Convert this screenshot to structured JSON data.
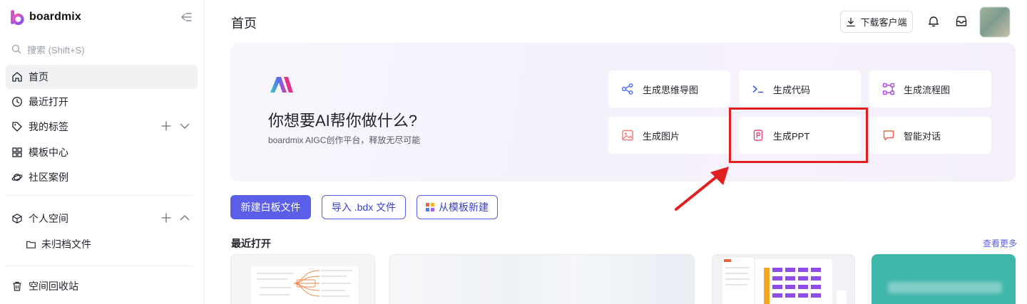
{
  "brand": {
    "name": "boardmix"
  },
  "sidebar": {
    "search_placeholder": "搜索 (Shift+S)",
    "items": [
      {
        "label": "首页",
        "icon": "home-icon",
        "active": true
      },
      {
        "label": "最近打开",
        "icon": "clock-icon"
      },
      {
        "label": "我的标签",
        "icon": "tag-icon"
      },
      {
        "label": "模板中心",
        "icon": "template-icon"
      },
      {
        "label": "社区案例",
        "icon": "planet-icon"
      }
    ],
    "personal_space": {
      "label": "个人空间",
      "icon": "cube-icon"
    },
    "unfiled": {
      "label": "未归档文件",
      "icon": "folder-icon"
    },
    "trash": {
      "label": "空间回收站",
      "icon": "trash-icon"
    }
  },
  "header": {
    "title": "首页",
    "download_label": "下载客户端"
  },
  "banner": {
    "title": "你想要AI帮你做什么?",
    "subtitle": "boardmix AIGC创作平台，释放无尽可能",
    "cards": [
      {
        "label": "生成思维导图",
        "icon": "mindmap-icon",
        "color": "#4a6cf7"
      },
      {
        "label": "生成代码",
        "icon": "code-icon",
        "color": "#3b5bdb"
      },
      {
        "label": "生成流程图",
        "icon": "flowchart-icon",
        "color": "#b04ae8"
      },
      {
        "label": "生成图片",
        "icon": "image-icon",
        "color": "#f07a7a"
      },
      {
        "label": "生成PPT",
        "icon": "ppt-icon",
        "color": "#e0457b"
      },
      {
        "label": "智能对话",
        "icon": "chat-icon",
        "color": "#f0604d"
      }
    ]
  },
  "actions": {
    "new_board": "新建白板文件",
    "import_bdx": "导入 .bdx 文件",
    "from_template": "从模板新建"
  },
  "recent": {
    "title": "最近打开",
    "more": "查看更多"
  },
  "colors": {
    "accent": "#5b5fe8",
    "highlight": "#e02020"
  }
}
